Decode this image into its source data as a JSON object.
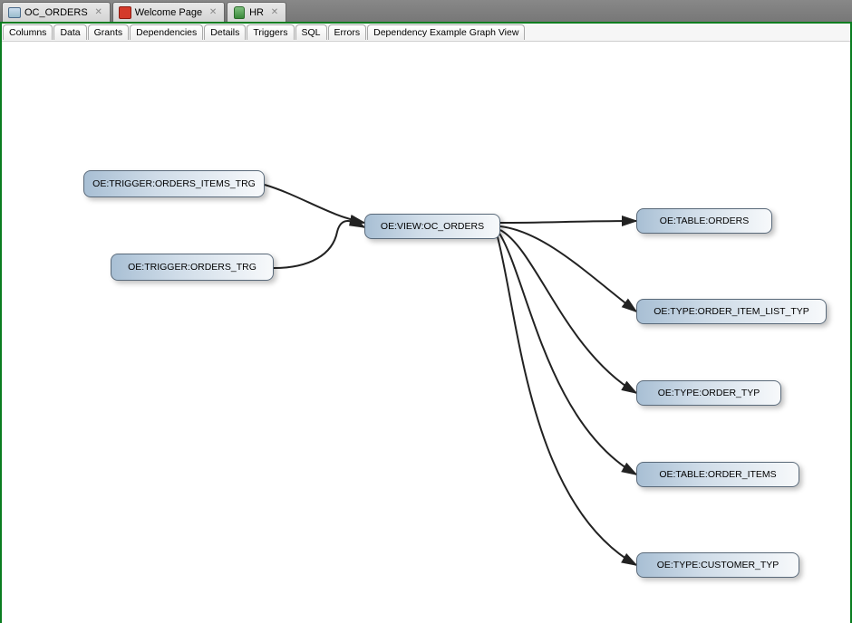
{
  "editor_tabs": [
    {
      "label": "OC_ORDERS",
      "icon": "view-icon"
    },
    {
      "label": "Welcome Page",
      "icon": "red-icon"
    },
    {
      "label": "HR",
      "icon": "db-icon"
    }
  ],
  "subtabs": [
    "Columns",
    "Data",
    "Grants",
    "Dependencies",
    "Details",
    "Triggers",
    "SQL",
    "Errors",
    "Dependency Example Graph View"
  ],
  "nodes": {
    "trigger_items": {
      "label": "OE:TRIGGER:ORDERS_ITEMS_TRG"
    },
    "trigger_orders": {
      "label": "OE:TRIGGER:ORDERS_TRG"
    },
    "view_oc_orders": {
      "label": "OE:VIEW:OC_ORDERS"
    },
    "table_orders": {
      "label": "OE:TABLE:ORDERS"
    },
    "type_item_list": {
      "label": "OE:TYPE:ORDER_ITEM_LIST_TYP"
    },
    "type_order": {
      "label": "OE:TYPE:ORDER_TYP"
    },
    "table_order_items": {
      "label": "OE:TABLE:ORDER_ITEMS"
    },
    "type_customer": {
      "label": "OE:TYPE:CUSTOMER_TYP"
    }
  },
  "chart_data": {
    "type": "dependency-graph",
    "title": "Dependency Example Graph View",
    "nodes": [
      {
        "id": "trigger_items",
        "label": "OE:TRIGGER:ORDERS_ITEMS_TRG"
      },
      {
        "id": "trigger_orders",
        "label": "OE:TRIGGER:ORDERS_TRG"
      },
      {
        "id": "view_oc_orders",
        "label": "OE:VIEW:OC_ORDERS"
      },
      {
        "id": "table_orders",
        "label": "OE:TABLE:ORDERS"
      },
      {
        "id": "type_item_list",
        "label": "OE:TYPE:ORDER_ITEM_LIST_TYP"
      },
      {
        "id": "type_order",
        "label": "OE:TYPE:ORDER_TYP"
      },
      {
        "id": "table_order_items",
        "label": "OE:TABLE:ORDER_ITEMS"
      },
      {
        "id": "type_customer",
        "label": "OE:TYPE:CUSTOMER_TYP"
      }
    ],
    "edges": [
      {
        "from": "trigger_items",
        "to": "view_oc_orders"
      },
      {
        "from": "trigger_orders",
        "to": "view_oc_orders"
      },
      {
        "from": "view_oc_orders",
        "to": "table_orders"
      },
      {
        "from": "view_oc_orders",
        "to": "type_item_list"
      },
      {
        "from": "view_oc_orders",
        "to": "type_order"
      },
      {
        "from": "view_oc_orders",
        "to": "table_order_items"
      },
      {
        "from": "view_oc_orders",
        "to": "type_customer"
      }
    ]
  }
}
